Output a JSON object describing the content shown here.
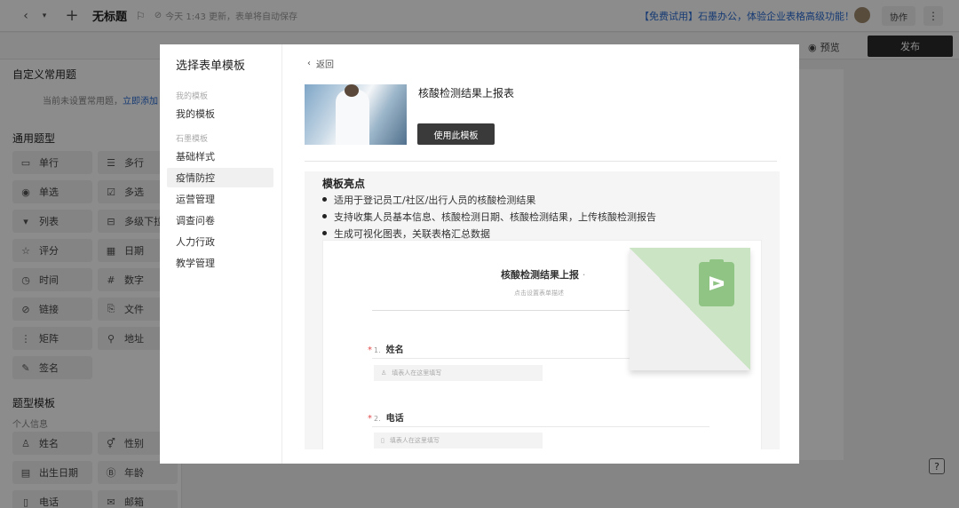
{
  "topbar": {
    "back_icon": "chevron-left-icon",
    "dropdown_icon": "caret-down-icon",
    "new_icon": "plus-icon",
    "title": "无标题",
    "status": "今天 1:43 更新，表单将自动保存",
    "promo": "【免费试用】石墨办公，体验企业表格高级功能！",
    "collab": "协作",
    "more": "⋮"
  },
  "subbar": {
    "preview": "预览",
    "publish": "发布"
  },
  "left": {
    "custom_title": "自定义常用题",
    "custom_note": "当前未设置常用题，",
    "custom_link": "立即添加",
    "general_title": "通用题型",
    "general_items": [
      {
        "icon": "▭",
        "label": "单行"
      },
      {
        "icon": "☰",
        "label": "多行"
      },
      {
        "icon": "◉",
        "label": "单选"
      },
      {
        "icon": "☑",
        "label": "多选"
      },
      {
        "icon": "▾",
        "label": "列表"
      },
      {
        "icon": "⊟",
        "label": "多级下拉"
      },
      {
        "icon": "☆",
        "label": "评分"
      },
      {
        "icon": "▦",
        "label": "日期"
      },
      {
        "icon": "◷",
        "label": "时间"
      },
      {
        "icon": "#",
        "label": "数字"
      },
      {
        "icon": "⊘",
        "label": "链接"
      },
      {
        "icon": "⎘",
        "label": "文件"
      },
      {
        "icon": "⋮",
        "label": "矩阵"
      },
      {
        "icon": "⚲",
        "label": "地址"
      },
      {
        "icon": "✎",
        "label": "签名"
      }
    ],
    "template_title": "题型模板",
    "template_sub": "个人信息",
    "template_items": [
      {
        "icon": "♙",
        "label": "姓名"
      },
      {
        "icon": "⚥",
        "label": "性别"
      },
      {
        "icon": "▤",
        "label": "出生日期"
      },
      {
        "icon": "Ⓑ",
        "label": "年龄"
      },
      {
        "icon": "▯",
        "label": "电话"
      },
      {
        "icon": "✉",
        "label": "邮箱"
      }
    ]
  },
  "modal": {
    "title": "选择表单模板",
    "group_mine": "我的模板",
    "mine_items": [
      "我的模板"
    ],
    "group_shimo": "石墨模板",
    "categories": [
      "基础样式",
      "疫情防控",
      "运营管理",
      "调查问卷",
      "人力行政",
      "教学管理"
    ],
    "active_category": "疫情防控",
    "back": "返回",
    "template_name": "核酸检测结果上报表",
    "use_button": "使用此模板",
    "highlights_title": "模板亮点",
    "highlights": [
      "适用于登记员工/社区/出行人员的核酸检测结果",
      "支持收集人员基本信息、核酸检测日期、核酸检测结果，上传核酸检测报告",
      "生成可视化图表，关联表格汇总数据"
    ],
    "preview": {
      "form_title": "核酸检测结果上报",
      "form_desc": "点击设置表单描述",
      "questions": [
        {
          "num": "1.",
          "label": "姓名",
          "placeholder": "填表人在这里填写"
        },
        {
          "num": "2.",
          "label": "电话",
          "placeholder": "填表人在这里填写"
        }
      ]
    }
  },
  "help": "?"
}
